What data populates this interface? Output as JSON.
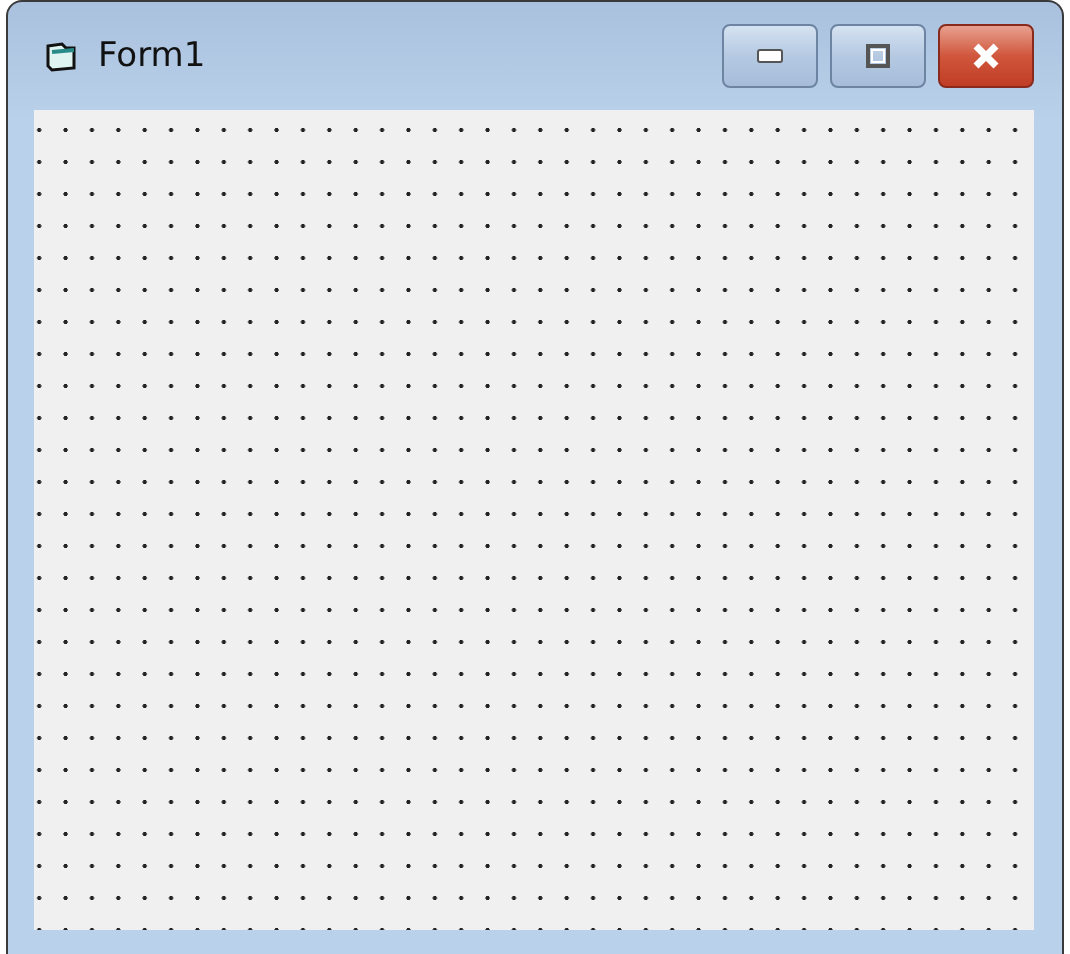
{
  "window": {
    "title": "Form1"
  }
}
